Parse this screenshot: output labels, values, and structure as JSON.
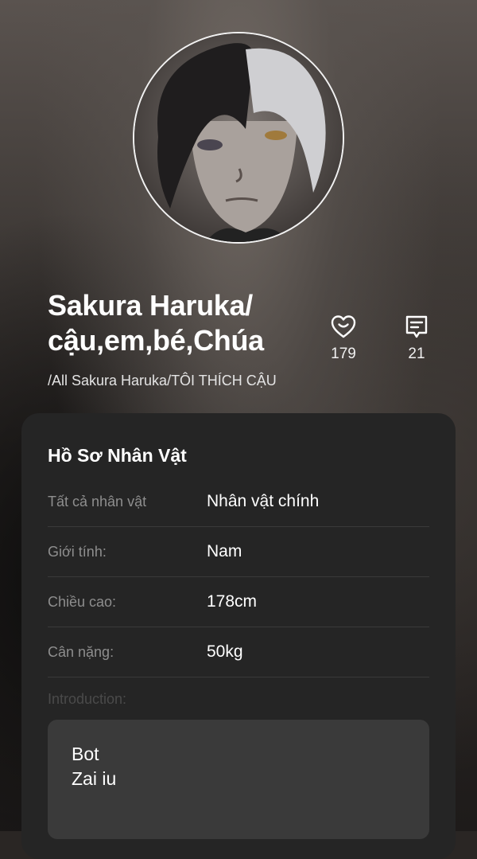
{
  "profile": {
    "name_line1": "Sakura Haruka/",
    "name_line2": "cậu,em,bé,Chúa",
    "subtitle": "/All Sakura Haruka/TÔI THÍCH CẬU",
    "likes_icon": "heart-smile-icon",
    "likes": "179",
    "comments_icon": "comment-icon",
    "comments": "21"
  },
  "card": {
    "title": "Hồ Sơ Nhân Vật",
    "rows": [
      {
        "label": "Tất cả nhân vật",
        "value": "Nhân vật chính"
      },
      {
        "label": "Giới tính:",
        "value": "Nam"
      },
      {
        "label": "Chiều cao:",
        "value": "178cm"
      },
      {
        "label": "Cân nặng:",
        "value": "50kg"
      }
    ],
    "intro_label": "Introduction:",
    "intro_text": "Bot\nZai iu"
  },
  "colors": {
    "card_bg": "#252525",
    "intro_bg": "#3a3a3a",
    "label": "#8e8e8e"
  }
}
